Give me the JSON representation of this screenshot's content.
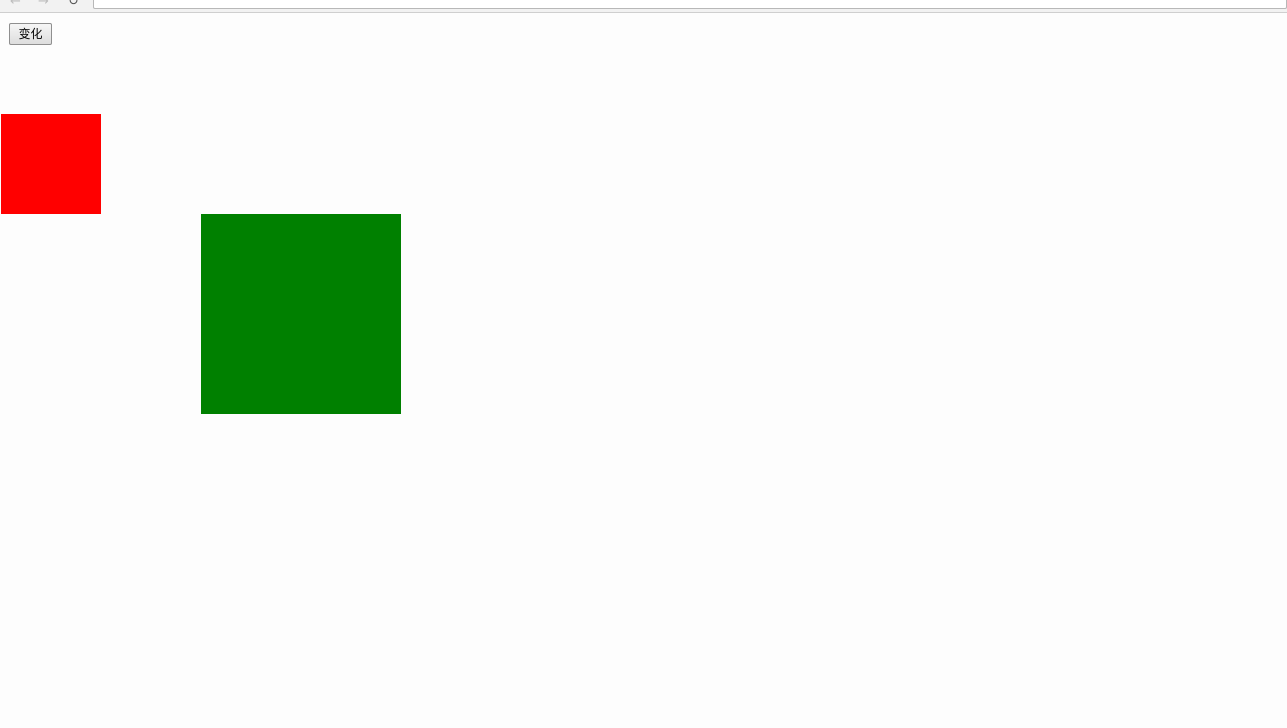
{
  "browser": {
    "back_icon": "back-arrow-icon",
    "forward_icon": "forward-arrow-icon",
    "reload_icon": "reload-icon"
  },
  "page": {
    "background": "#fdfdfd",
    "change_button_label": "变化",
    "red_box_color": "#ff0000",
    "green_box_color": "#008000"
  }
}
